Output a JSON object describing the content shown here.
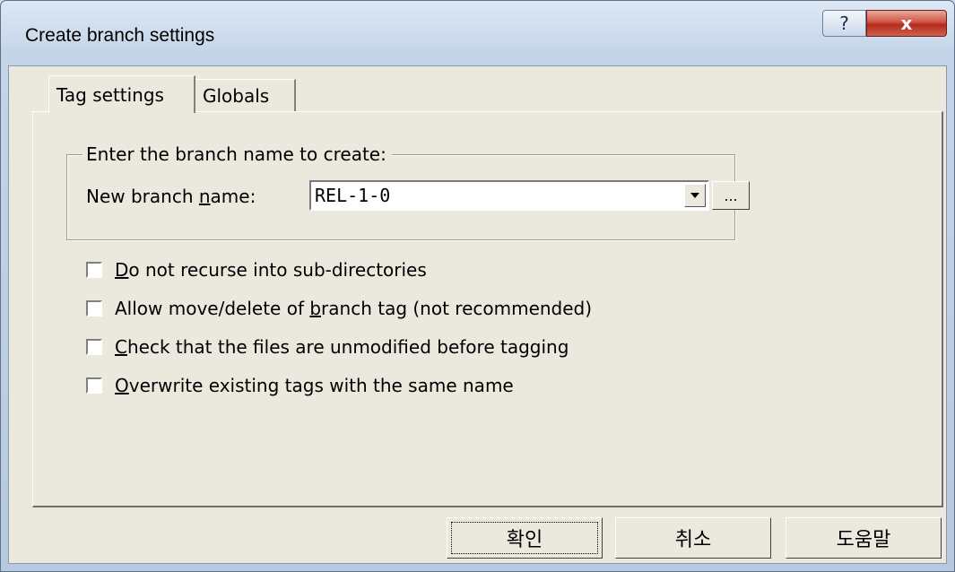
{
  "window": {
    "title": "Create branch settings",
    "help_glyph": "?",
    "close_glyph": "x"
  },
  "tabs": [
    {
      "label": "Tag settings",
      "active": true
    },
    {
      "label": "Globals",
      "active": false
    }
  ],
  "branch_group": {
    "legend": "Enter the branch name to create:",
    "field_label_pre": "New branch ",
    "field_label_mnemonic": "n",
    "field_label_post": "ame:",
    "value": "REL-1-0",
    "browse_label": "..."
  },
  "options": [
    {
      "mnemonic": "D",
      "rest": "o not recurse into sub-directories",
      "checked": false
    },
    {
      "pre": "Allow move/delete of ",
      "mnemonic": "b",
      "rest": "ranch tag (not recommended)",
      "checked": false
    },
    {
      "mnemonic": "C",
      "rest": "heck that the files are unmodified before tagging",
      "checked": false
    },
    {
      "mnemonic": "O",
      "rest": "verwrite existing tags with the same name",
      "checked": false
    }
  ],
  "buttons": {
    "ok": "확인",
    "cancel": "취소",
    "help": "도움말"
  },
  "colors": {
    "dialog_face": "#ebe8de",
    "frame": "#c4d4e8",
    "close_red": "#c43a2a"
  }
}
